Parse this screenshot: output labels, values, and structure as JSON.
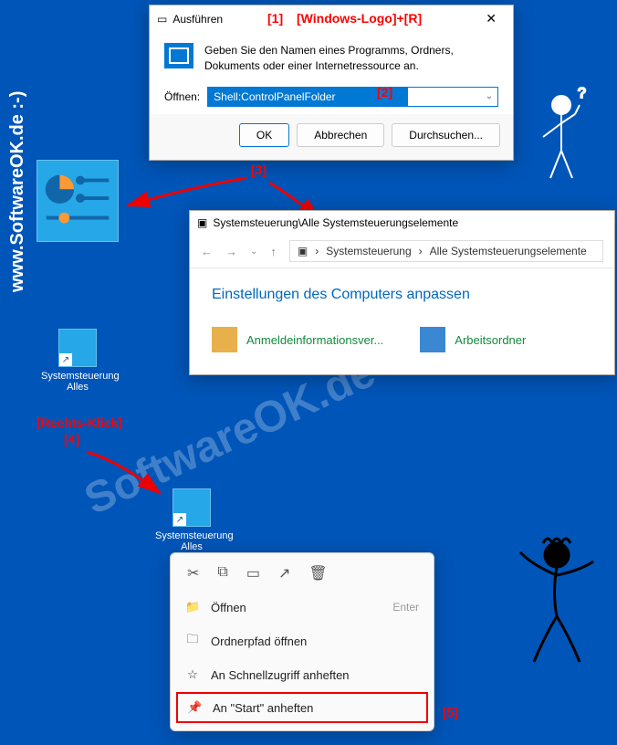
{
  "watermark_left": "www.SoftwareOK.de :-)",
  "watermark_diag": "SoftwareOK.de",
  "run_dialog": {
    "title": "Ausführen",
    "body_text": "Geben Sie den Namen eines Programms, Ordners, Dokuments oder einer Internetressource an.",
    "open_label": "Öffnen:",
    "input_value": "Shell:ControlPanelFolder",
    "ok": "OK",
    "cancel": "Abbrechen",
    "browse": "Durchsuchen..."
  },
  "desktop_icon_label": "Systemsteuerung Alles",
  "explorer": {
    "title": "Systemsteuerung\\Alle Systemsteuerungselemente",
    "crumb1": "Systemsteuerung",
    "crumb2": "Alle Systemsteuerungselemente",
    "heading": "Einstellungen des Computers anpassen",
    "item1": "Anmeldeinformationsver...",
    "item2": "Arbeitsordner"
  },
  "context_menu": {
    "open": "Öffnen",
    "open_shortcut": "Enter",
    "open_path": "Ordnerpfad öffnen",
    "pin_quickaccess": "An Schnellzugriff anheften",
    "pin_start": "An \"Start\" anheften"
  },
  "annotations": {
    "a1": "[1]",
    "a1b": "[Windows-Logo]+[R]",
    "a2": "[2]",
    "a3": "[3]",
    "a4_top": "[Rechts-Klick]",
    "a4": "[4]",
    "a5": "[5]"
  }
}
